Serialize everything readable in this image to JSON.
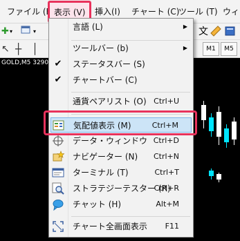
{
  "menubar": {
    "items": [
      {
        "label": "ファイル (F)"
      },
      {
        "label": "表示 (V)"
      },
      {
        "label": "挿入(I)"
      },
      {
        "label": "チャート (C)"
      },
      {
        "label": "ツール (T)"
      },
      {
        "label": "ウィン"
      }
    ]
  },
  "toolbar": {
    "right_text": "文",
    "timeframes": [
      "M1",
      "M5"
    ]
  },
  "chart": {
    "symbol": "GOLD,M5  3290."
  },
  "view_menu": {
    "items": [
      {
        "label": "言語 (L)",
        "shortcut": "",
        "icon": "none",
        "has_submenu": true
      },
      {
        "label": "ツールバー (b)",
        "shortcut": "",
        "icon": "none",
        "has_submenu": true
      },
      {
        "label": "ステータスバー (S)",
        "shortcut": "",
        "icon": "check-icon",
        "has_submenu": false
      },
      {
        "label": "チャートバー (C)",
        "shortcut": "",
        "icon": "check-icon",
        "has_submenu": false
      },
      {
        "label": "通貨ペアリスト (O)",
        "shortcut": "Ctrl+U",
        "icon": "none",
        "has_submenu": false
      },
      {
        "label": "気配値表示 (M)",
        "shortcut": "Ctrl+M",
        "icon": "market-watch-icon",
        "has_submenu": false
      },
      {
        "label": "データ・ウィンドウ",
        "shortcut": "Ctrl+D",
        "icon": "crosshair-icon",
        "has_submenu": false
      },
      {
        "label": "ナビゲーター (N)",
        "shortcut": "Ctrl+N",
        "icon": "navigator-star-icon",
        "has_submenu": false
      },
      {
        "label": "ターミナル (T)",
        "shortcut": "Ctrl+T",
        "icon": "terminal-icon",
        "has_submenu": false
      },
      {
        "label": "ストラテジーテスター (R)",
        "shortcut": "Ctrl+R",
        "icon": "tester-magnifier-icon",
        "has_submenu": false
      },
      {
        "label": "チャット (H)",
        "shortcut": "Alt+M",
        "icon": "chat-bubble-icon",
        "has_submenu": false
      },
      {
        "label": "チャート全画面表示",
        "shortcut": "F11",
        "icon": "fullscreen-icon",
        "has_submenu": false
      }
    ]
  },
  "colors": {
    "highlight_border": "#e8325c",
    "menu_hover_bg": "#cce4f7",
    "candle_up": "#00e5ff",
    "candle_down": "#ffffff"
  }
}
